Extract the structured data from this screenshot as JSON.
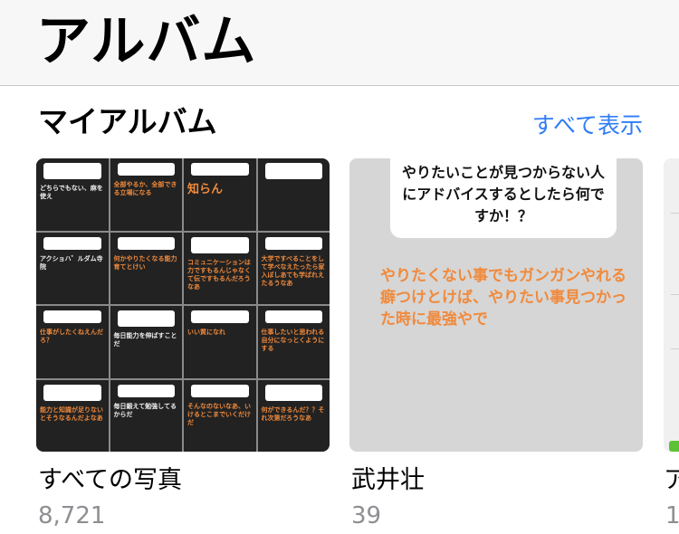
{
  "header": {
    "title": "アルバム"
  },
  "section": {
    "title": "マイアルバム",
    "see_all": "すべて表示"
  },
  "albums": [
    {
      "name": "すべての写真",
      "count": "8,721",
      "tiles": [
        {
          "text": "どちらでもない、麻を使え",
          "style": "w"
        },
        {
          "text": "全部やるか、全部できる立場になる",
          "style": ""
        },
        {
          "text": "知らん",
          "style": "big"
        },
        {
          "text": "",
          "style": ""
        },
        {
          "text": "アクショハ゛ルダム寺院",
          "style": "w"
        },
        {
          "text": "何かやりたくなる能力育てとけい",
          "style": ""
        },
        {
          "text": "コミュニケーションは力ですもるんじゃなくて伝ですもるんだろうなあ",
          "style": ""
        },
        {
          "text": "大学ですべることをして学べなえたったら家入ぼしあても学ばれえたるうなあ",
          "style": ""
        },
        {
          "text": "仕事がしたくねえんだろ？",
          "style": ""
        },
        {
          "text": "毎日能力を伸ばすことだ",
          "style": "w"
        },
        {
          "text": "いい質になれ",
          "style": ""
        },
        {
          "text": "仕事したいと思われる自分になっとくようにする",
          "style": ""
        },
        {
          "text": "能力と知識が足りないとそうなるんだよなあ",
          "style": ""
        },
        {
          "text": "毎日鍛えて勉強してるからだ",
          "style": "w"
        },
        {
          "text": "そんなのないなあ、いけるとこまでいくだけだ",
          "style": ""
        },
        {
          "text": "何ができるんだ？？それ次第だろうなあ",
          "style": ""
        }
      ]
    },
    {
      "name": "武井壮",
      "count": "39",
      "question": "やりたいことが見つからない人にアドバイスするとしたら何ですか！？",
      "answer": "やりたくない事でもガンガンやれる癖つけとけば、やりたい事見つかった時に最強やで"
    }
  ],
  "partial_album": {
    "name": "ア",
    "count": "1"
  },
  "colors": {
    "accent": "#2f7cf6",
    "answer_orange": "#f08a3c",
    "secondary_text": "#8e8e93"
  }
}
